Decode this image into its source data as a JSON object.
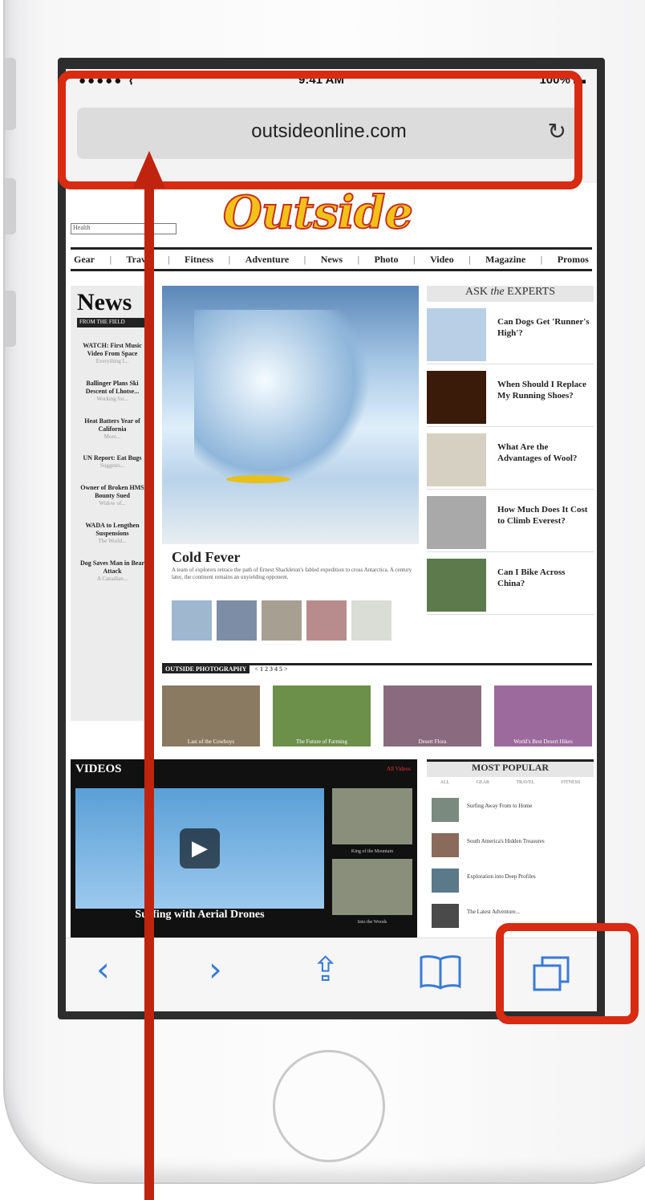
{
  "status_bar": {
    "carrier": "●●●●● ⌇",
    "time": "9:41 AM",
    "battery": "100% ▬"
  },
  "browser": {
    "url": "outsideonline.com",
    "reload_icon": "reload-icon"
  },
  "site": {
    "logo": "Outside",
    "section_select": "Health",
    "nav": [
      "Gear",
      "Travel",
      "Fitness",
      "Adventure",
      "News",
      "Photo",
      "Video",
      "Magazine",
      "Promos"
    ],
    "news": {
      "heading": "News",
      "subheading": "FROM THE FIELD",
      "items": [
        {
          "title": "WATCH: First Music Video From Space",
          "meta": "Everything I..."
        },
        {
          "title": "Ballinger Plans Ski Descent of Lhotse...",
          "meta": "Working for..."
        },
        {
          "title": "Heat Batters Year of California",
          "meta": "More..."
        },
        {
          "title": "UN Report: Eat Bugs",
          "meta": "Suggests..."
        },
        {
          "title": "Owner of Broken HMS Bounty Sued",
          "meta": "Widow of..."
        },
        {
          "title": "WADA to Lengthen Suspensions",
          "meta": "The World..."
        },
        {
          "title": "Dog Saves Man in Bear Attack",
          "meta": "A Canadian..."
        }
      ]
    },
    "hero": {
      "title": "Cold Fever",
      "text": "A team of explorers retrace the path of Ernest Shackleton's fabled expedition to cross Antarctica. A century later, the continent remains an unyielding opponent."
    },
    "experts": {
      "heading_pre": "ASK",
      "heading_em": "the",
      "heading_post": "EXPERTS",
      "items": [
        "Can Dogs Get 'Runner's High'?",
        "When Should I Replace My Running Shoes?",
        "What Are the Advantages of Wool?",
        "How Much Does It Cost to Climb Everest?",
        "Can I Bike Across China?"
      ]
    },
    "photography": {
      "heading": "OUTSIDE PHOTOGRAPHY",
      "pager": "< 1 2 3 4 5 >",
      "items": [
        "Last of the Cowboys",
        "The Future of Farming",
        "Desert Flora",
        "World's Best Desert Hikes"
      ]
    },
    "videos": {
      "heading": "VIDEOS",
      "all_label": "All Videos",
      "main_caption": "Surfing with Aerial Drones",
      "side_captions": [
        "King of the Mountain",
        "Into the Woods"
      ]
    },
    "popular": {
      "heading": "MOST POPULAR",
      "tabs": [
        "ALL",
        "GEAR",
        "TRAVEL",
        "FITNESS"
      ],
      "items": [
        "Surfing Away From to Home",
        "South America's Hidden Treasures",
        "Exploration into Deep Profiles",
        "The Latest Adventure..."
      ]
    }
  },
  "toolbar": {
    "back": "‹",
    "forward": "›",
    "share": "⇪",
    "bookmarks": "📖",
    "tabs": "⧉"
  },
  "colors": {
    "annotation": "#d92a12",
    "ios_blue": "#3a7bd5",
    "logo_yellow": "#f3c218",
    "logo_red": "#c4331f"
  }
}
